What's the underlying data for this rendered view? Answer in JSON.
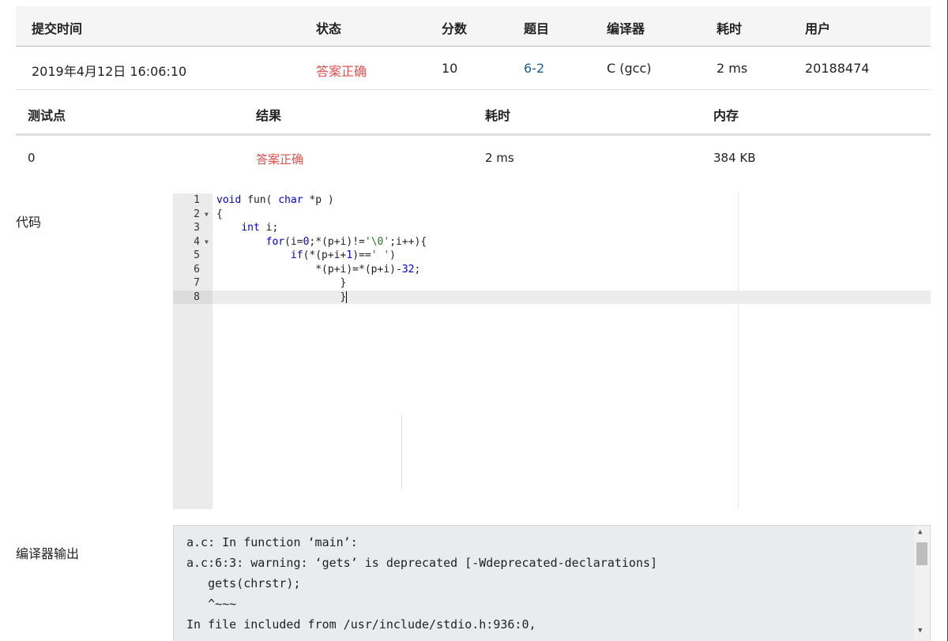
{
  "submission": {
    "headers": [
      "提交时间",
      "状态",
      "分数",
      "题目",
      "编译器",
      "耗时",
      "用户"
    ],
    "row": {
      "time": "2019年4月12日 16:06:10",
      "status": "答案正确",
      "score": "10",
      "problem": "6-2",
      "compiler": "C (gcc)",
      "elapsed": "2 ms",
      "user": "20188474"
    }
  },
  "testpoints": {
    "headers": [
      "测试点",
      "结果",
      "耗时",
      "内存"
    ],
    "rows": [
      {
        "id": "0",
        "result": "答案正确",
        "elapsed": "2 ms",
        "memory": "384 KB"
      }
    ]
  },
  "code_label": "代码",
  "code": {
    "line_numbers": [
      "1",
      "2",
      "3",
      "4",
      "5",
      "6",
      "7",
      "8"
    ],
    "lines": [
      "void fun( char *p )",
      "{",
      "    int i;",
      "        for(i=0;*(p+i)!='\\0';i++){",
      "            if(*(p+i+1)==' ')",
      "                *(p+i)=*(p+i)-32;",
      "                    }",
      "                    }"
    ],
    "fold_icon": "triangle-down-icon",
    "active_line": "8"
  },
  "compiler_output_label": "编译器输出",
  "compiler_output": [
    "a.c: In function ‘main’:",
    "a.c:6:3: warning: ‘gets’ is deprecated [-Wdeprecated-declarations]",
    "   gets(chrstr);",
    "   ^~~~",
    "In file included from /usr/include/stdio.h:936:0,"
  ],
  "colors": {
    "accepted": "#d9534f",
    "problem_link": "#1f5d8c",
    "header_bg": "#f5f5f5",
    "output_bg": "#e9ebee"
  }
}
